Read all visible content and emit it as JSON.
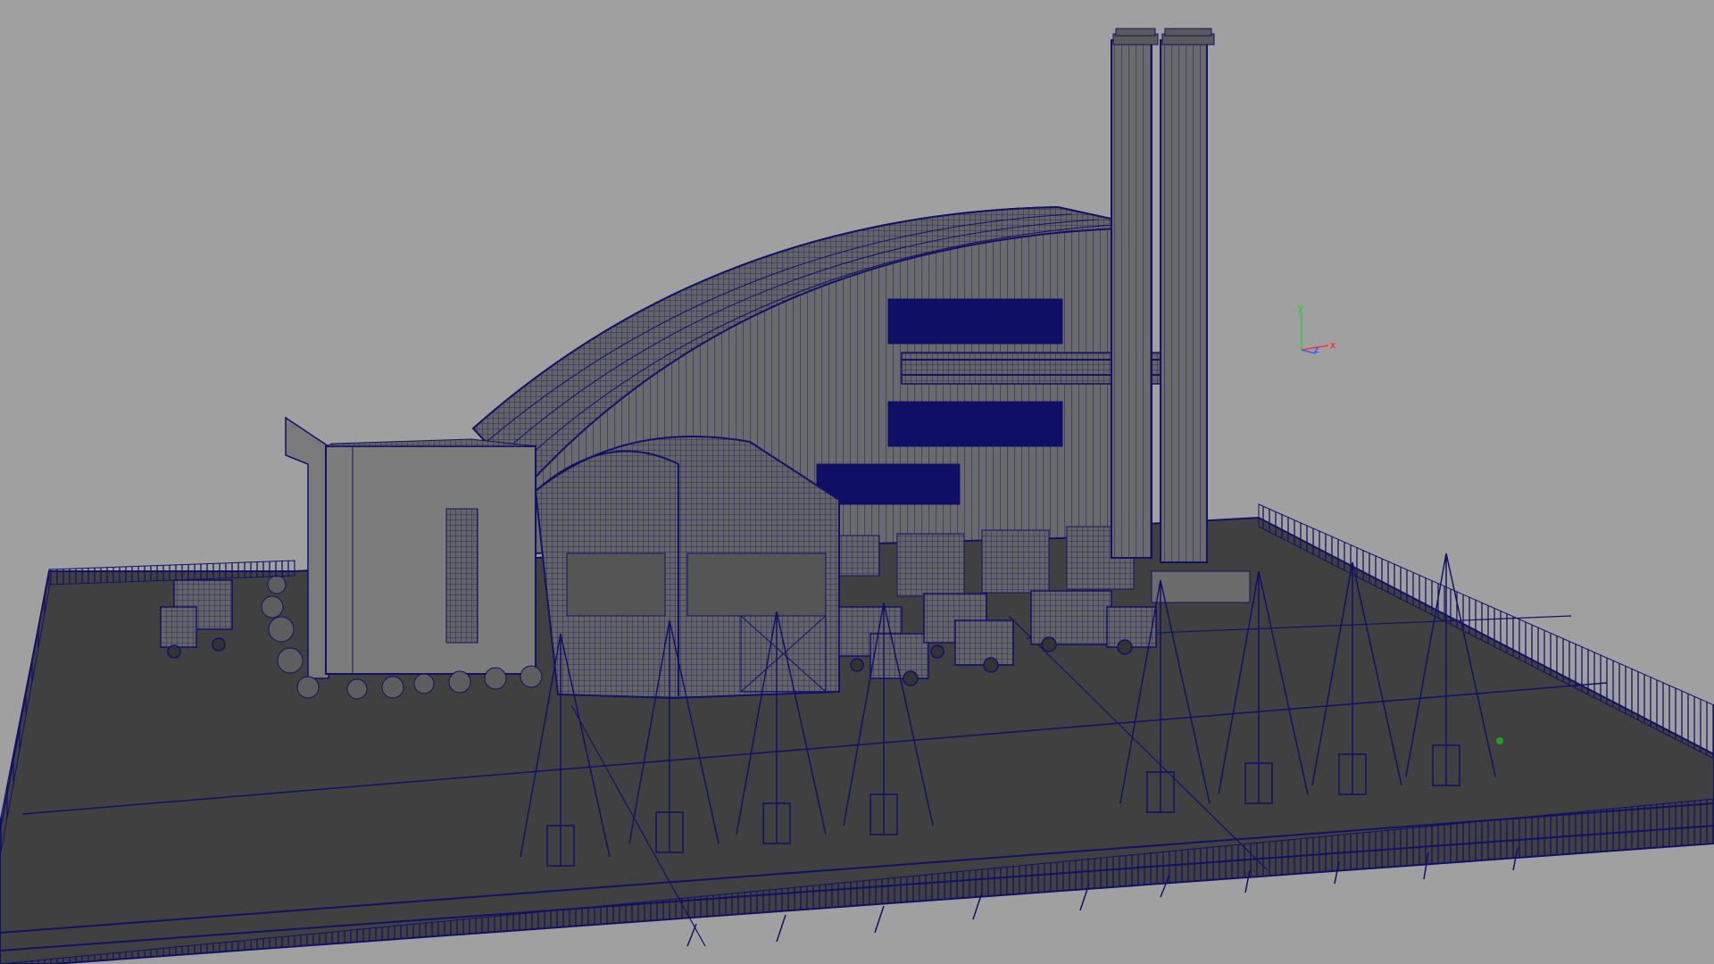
{
  "viewport": {
    "background_color": "#a0a0a0",
    "ground_color": "#404040",
    "wire_color": "#111166",
    "fill_color": "#6e6e6e",
    "glass_color": "#0f0f66"
  },
  "axis_gizmo": {
    "x_label": "x",
    "y_label": "y",
    "z_label": "z",
    "x_color": "#ff3030",
    "y_color": "#30d030",
    "z_color": "#3060ff"
  },
  "scene": {
    "objects": [
      "main-hall",
      "chimney",
      "chimney",
      "annex-building",
      "arched-entrance",
      "garbage-truck",
      "garbage-truck",
      "garbage-truck",
      "garbage-truck",
      "crane",
      "crane",
      "crane",
      "crane",
      "crane",
      "crane",
      "crane",
      "crane",
      "perimeter-fence",
      "ground-plane"
    ],
    "vehicle_count": 4,
    "crane_count": 8
  }
}
